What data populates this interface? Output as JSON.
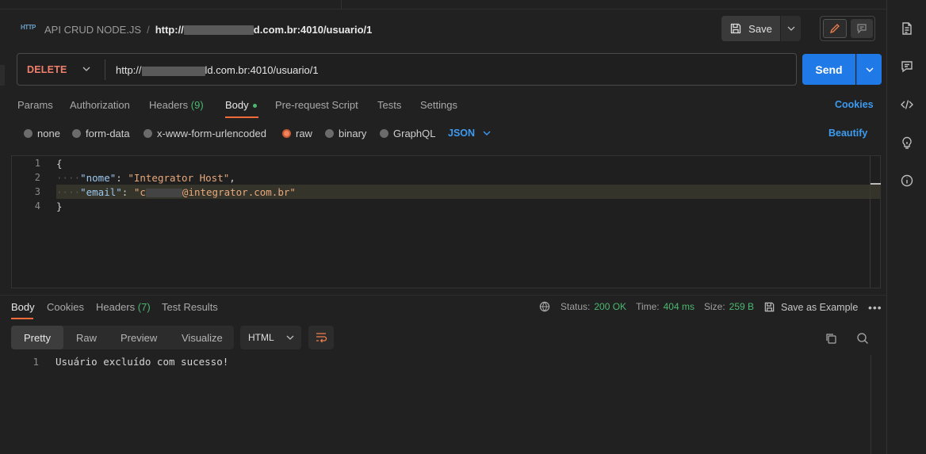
{
  "breadcrumb": {
    "icon": "http-icon",
    "icon_text": "HTTP",
    "collection": "API CRUD NODE.JS",
    "separator": "/",
    "url_prefix": "http://",
    "url_suffix": "d.com.br:4010/usuario/1"
  },
  "toolbar": {
    "save_label": "Save"
  },
  "request": {
    "method": "DELETE",
    "url_prefix": "http://",
    "url_suffix": "ld.com.br:4010/usuario/1",
    "send_label": "Send"
  },
  "request_tabs": [
    {
      "label": "Params"
    },
    {
      "label": "Authorization"
    },
    {
      "label": "Headers",
      "count": "(9)"
    },
    {
      "label": "Body"
    },
    {
      "label": "Pre-request Script"
    },
    {
      "label": "Tests"
    },
    {
      "label": "Settings"
    }
  ],
  "cookies_link": "Cookies",
  "body_types": [
    "none",
    "form-data",
    "x-www-form-urlencoded",
    "raw",
    "binary",
    "GraphQL"
  ],
  "body_selected": "raw",
  "body_language": "JSON",
  "beautify_label": "Beautify",
  "editor": {
    "line_numbers": [
      "1",
      "2",
      "3",
      "4"
    ],
    "open_brace": "{",
    "close_brace": "}",
    "nome_key": "\"nome\"",
    "nome_value": "\"Integrator Host\"",
    "email_key": "\"email\"",
    "email_value_start": "\"c",
    "email_value_end": "@integrator.com.br\""
  },
  "response_tabs": [
    {
      "label": "Body"
    },
    {
      "label": "Cookies"
    },
    {
      "label": "Headers",
      "count": "(7)"
    },
    {
      "label": "Test Results"
    }
  ],
  "response_status": {
    "status_label": "Status:",
    "status_value": "200 OK",
    "time_label": "Time:",
    "time_value": "404 ms",
    "size_label": "Size:",
    "size_value": "259 B",
    "save_example": "Save as Example"
  },
  "response_view": {
    "options": [
      "Pretty",
      "Raw",
      "Preview",
      "Visualize"
    ],
    "selected": "Pretty",
    "format": "HTML"
  },
  "response_body": {
    "line_number": "1",
    "text": "Usuário excluído com sucesso!"
  },
  "colors": {
    "accent": "#1f7ae8",
    "method_delete": "#f07f6c",
    "status_ok": "#4bb870",
    "tab_underline": "#f26b3a"
  }
}
